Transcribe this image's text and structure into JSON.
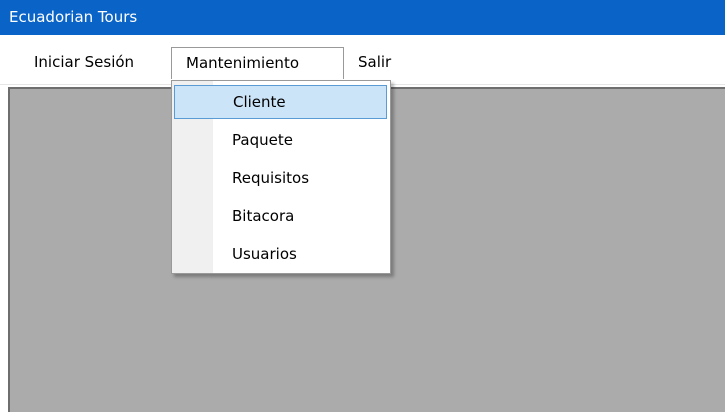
{
  "window": {
    "title": "Ecuadorian Tours",
    "title_bar_color": "#0a64c8"
  },
  "menubar": {
    "items": [
      {
        "label": "Iniciar Sesión"
      },
      {
        "label": "Mantenimiento",
        "open": true
      },
      {
        "label": "Salir"
      }
    ]
  },
  "dropdown": {
    "items": [
      {
        "label": "Cliente",
        "highlighted": true
      },
      {
        "label": "Paquete"
      },
      {
        "label": "Requisitos"
      },
      {
        "label": "Bitacora"
      },
      {
        "label": "Usuarios"
      }
    ],
    "highlight_color": "#cce4f7"
  },
  "mdi_background_color": "#ababab"
}
